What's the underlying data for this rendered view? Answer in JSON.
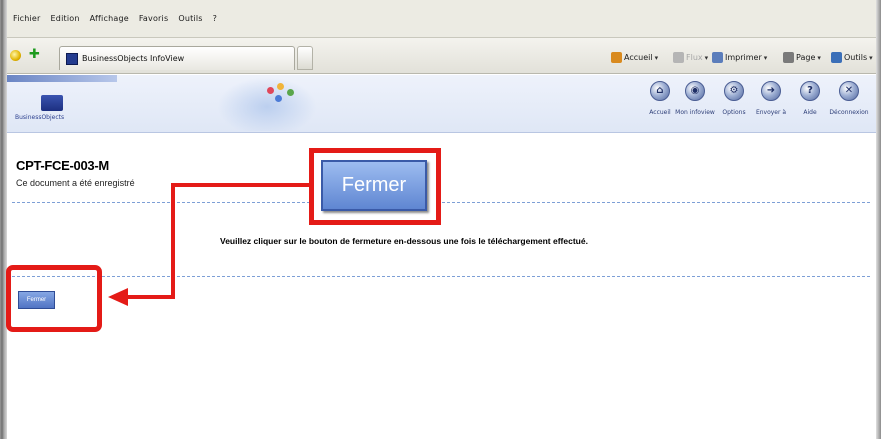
{
  "menu": [
    "Fichier",
    "Edition",
    "Affichage",
    "Favoris",
    "Outils",
    "?"
  ],
  "tab": {
    "title": "BusinessObjects InfoView"
  },
  "command_bar": [
    {
      "label": "Accueil",
      "icon": "home-icon",
      "has_menu": true,
      "disabled": false,
      "color": "#d98a1e"
    },
    {
      "label": "Flux",
      "icon": "feeds-icon",
      "has_menu": true,
      "disabled": true,
      "color": "#b5b5b5"
    },
    {
      "label": "Imprimer",
      "icon": "print-icon",
      "has_menu": true,
      "disabled": false,
      "color": "#5b7dbb"
    },
    {
      "label": "Page",
      "icon": "page-icon",
      "has_menu": true,
      "disabled": false,
      "color": "#7a7a7a"
    },
    {
      "label": "Outils",
      "icon": "tools-icon",
      "has_menu": true,
      "disabled": false,
      "color": "#3b6fb8"
    }
  ],
  "bo_header": {
    "logo_text": "BusinessObjects",
    "buttons": [
      {
        "label": "Accueil",
        "icon": "home-icon"
      },
      {
        "label": "Mon infoview",
        "icon": "my-infoview-icon"
      },
      {
        "label": "Options",
        "icon": "options-icon"
      },
      {
        "label": "Envoyer à",
        "icon": "send-to-icon"
      },
      {
        "label": "Aide",
        "icon": "help-icon"
      },
      {
        "label": "Déconnexion",
        "icon": "logout-icon"
      }
    ]
  },
  "document": {
    "title": "CPT-FCE-003-M",
    "message": "Ce document a été enregistré",
    "instruction": "Veuillez cliquer  sur le bouton de fermeture en-dessous  une fois le téléchargement effectué.",
    "close_label": "Fermer"
  },
  "callout": {
    "zoom_label": "Fermer",
    "color": "#e41b17"
  }
}
